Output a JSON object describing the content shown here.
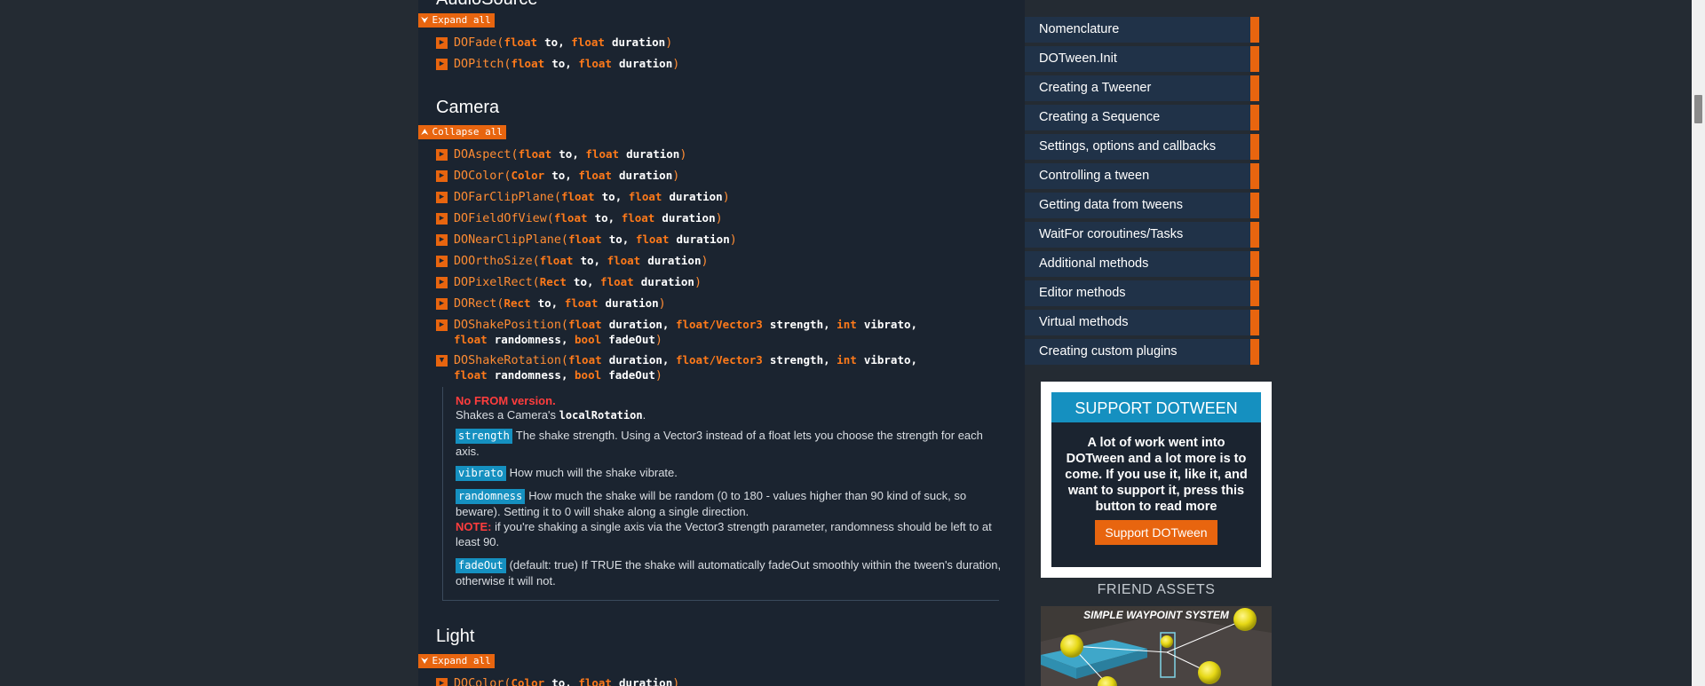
{
  "main": {
    "audiosource": {
      "title": "AudioSource",
      "toggle": "Expand all",
      "methods": [
        {
          "name": "DOFade(",
          "params": [
            [
              "float",
              "to"
            ],
            [
              "float",
              "duration"
            ]
          ]
        },
        {
          "name": "DOPitch(",
          "params": [
            [
              "float",
              "to"
            ],
            [
              "float",
              "duration"
            ]
          ]
        }
      ]
    },
    "camera": {
      "title": "Camera",
      "toggle": "Collapse all",
      "methods": [
        {
          "name": "DOAspect(",
          "params": [
            [
              "float",
              "to"
            ],
            [
              "float",
              "duration"
            ]
          ]
        },
        {
          "name": "DOColor(",
          "params": [
            [
              "Color",
              "to"
            ],
            [
              "float",
              "duration"
            ]
          ]
        },
        {
          "name": "DOFarClipPlane(",
          "params": [
            [
              "float",
              "to"
            ],
            [
              "float",
              "duration"
            ]
          ]
        },
        {
          "name": "DOFieldOfView(",
          "params": [
            [
              "float",
              "to"
            ],
            [
              "float",
              "duration"
            ]
          ]
        },
        {
          "name": "DONearClipPlane(",
          "params": [
            [
              "float",
              "to"
            ],
            [
              "float",
              "duration"
            ]
          ]
        },
        {
          "name": "DOOrthoSize(",
          "params": [
            [
              "float",
              "to"
            ],
            [
              "float",
              "duration"
            ]
          ]
        },
        {
          "name": "DOPixelRect(",
          "params": [
            [
              "Rect",
              "to"
            ],
            [
              "float",
              "duration"
            ]
          ]
        },
        {
          "name": "DORect(",
          "params": [
            [
              "Rect",
              "to"
            ],
            [
              "float",
              "duration"
            ]
          ]
        },
        {
          "name": "DOShakePosition(",
          "params": [
            [
              "float",
              "duration"
            ],
            [
              "float/Vector3",
              "strength"
            ],
            [
              "int",
              "vibrato"
            ],
            [
              "float",
              "randomness"
            ],
            [
              "bool",
              "fadeOut"
            ]
          ]
        },
        {
          "name": "DOShakeRotation(",
          "params": [
            [
              "float",
              "duration"
            ],
            [
              "float/Vector3",
              "strength"
            ],
            [
              "int",
              "vibrato"
            ],
            [
              "float",
              "randomness"
            ],
            [
              "bool",
              "fadeOut"
            ]
          ]
        }
      ],
      "detail": {
        "nofrom": "No FROM version.",
        "desc_prefix": "Shakes a Camera's ",
        "desc_code": "localRotation",
        "desc_suffix": ".",
        "params": [
          {
            "tag": "strength",
            "text": "The shake strength. Using a Vector3 instead of a float lets you choose the strength for each axis."
          },
          {
            "tag": "vibrato",
            "text": "How much will the shake vibrate."
          },
          {
            "tag": "randomness",
            "text": "How much the shake will be random (0 to 180 - values higher than 90 kind of suck, so beware). Setting it to 0 will shake along a single direction.",
            "note_label": "NOTE:",
            "note": " if you're shaking a single axis via the Vector3 strength parameter, randomness should be left to at least 90."
          },
          {
            "tag": "fadeOut",
            "text": "(default: true) If TRUE the shake will automatically fadeOut smoothly within the tween's duration, otherwise it will not."
          }
        ]
      }
    },
    "light": {
      "title": "Light",
      "toggle": "Expand all",
      "methods": [
        {
          "name": "DOColor(",
          "params": [
            [
              "Color",
              "to"
            ],
            [
              "float",
              "duration"
            ]
          ]
        }
      ]
    }
  },
  "sidebar": {
    "nav": [
      "Nomenclature",
      "DOTween.Init",
      "Creating a Tweener",
      "Creating a Sequence",
      "Settings, options and callbacks",
      "Controlling a tween",
      "Getting data from tweens",
      "WaitFor coroutines/Tasks",
      "Additional methods",
      "Editor methods",
      "Virtual methods",
      "Creating custom plugins"
    ],
    "support": {
      "title": "SUPPORT DOTWEEN",
      "text": "A lot of work went into DOTween and a lot more is to come. If you use it, like it, and want to support it, press this button to read more",
      "button": "Support DOTween"
    },
    "friend": {
      "title": "FRIEND ASSETS",
      "caption": "SIMPLE WAYPOINT SYSTEM"
    }
  },
  "colors": {
    "accent": "#e8650f",
    "tag": "#1590c0",
    "nav_bg": "#203248",
    "main_bg": "#1b2430"
  }
}
